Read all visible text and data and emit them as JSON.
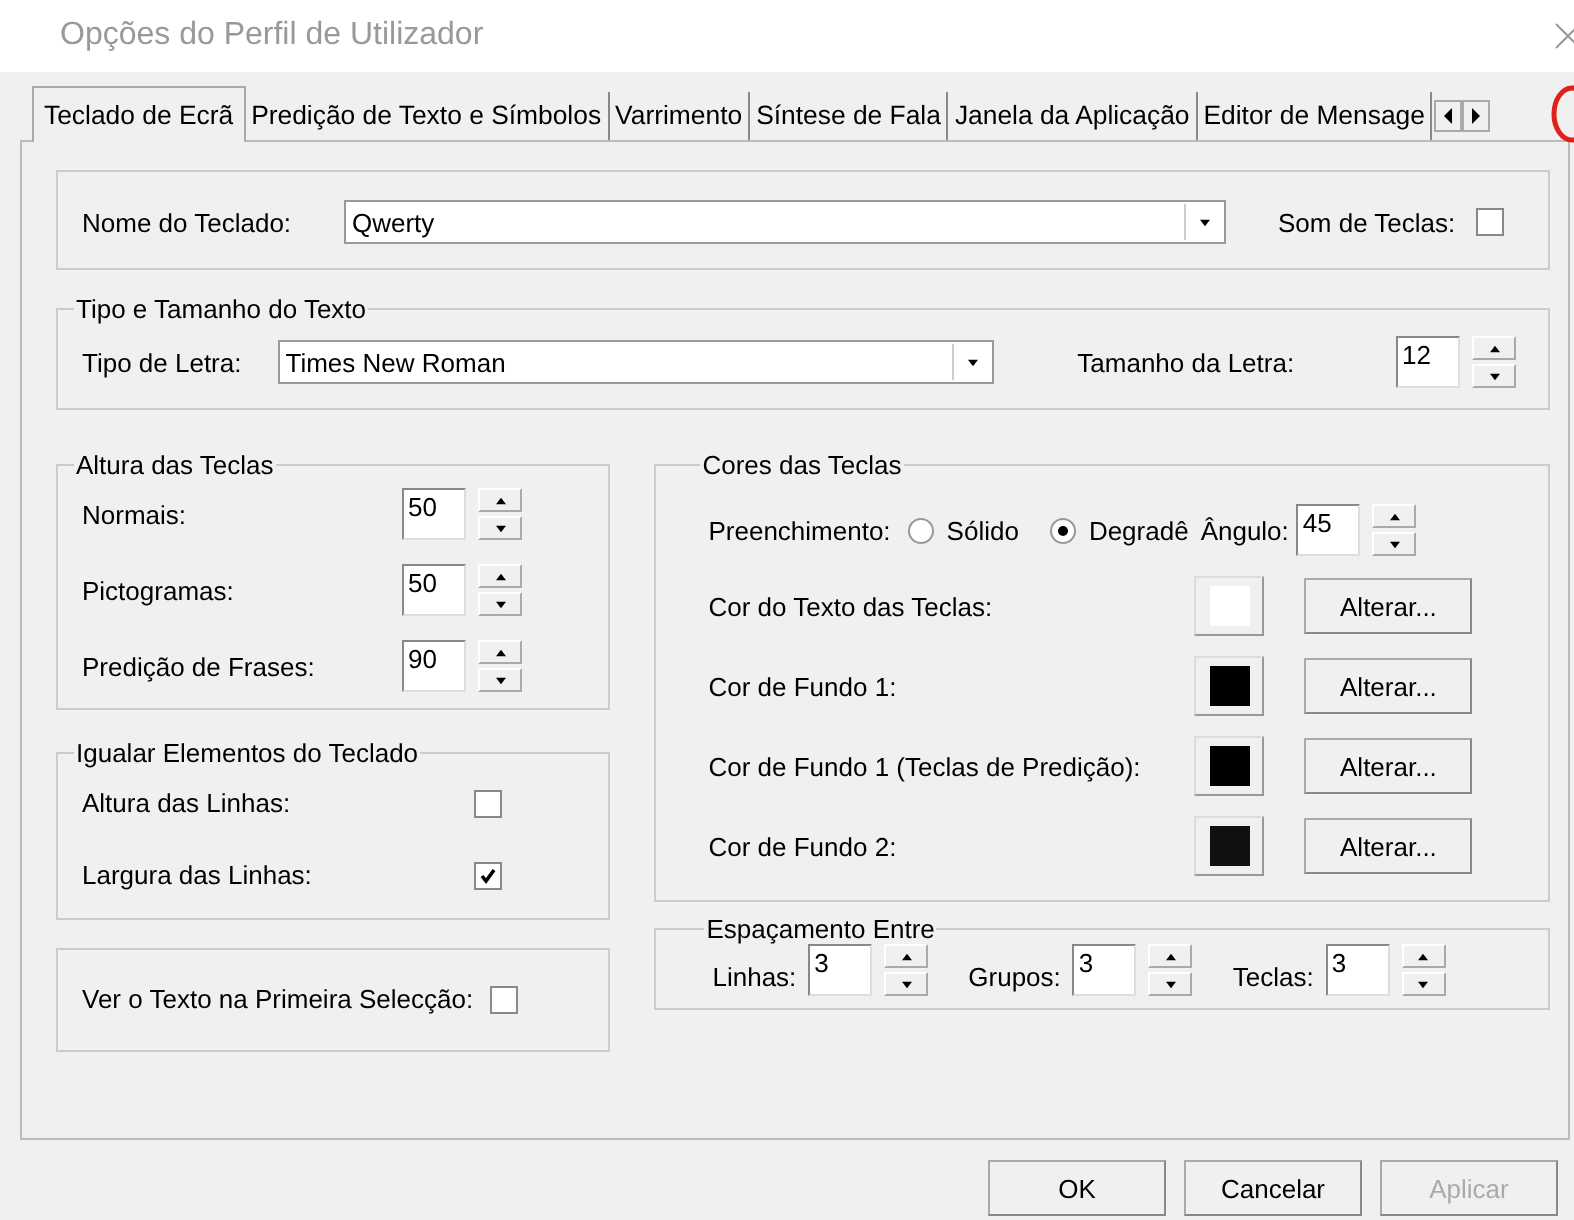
{
  "window": {
    "title": "Opções do Perfil de Utilizador"
  },
  "tabs": [
    {
      "label": "Teclado de Ecrã",
      "selected": true
    },
    {
      "label": "Predição de Texto e Símbolos",
      "selected": false
    },
    {
      "label": "Varrimento",
      "selected": false
    },
    {
      "label": "Síntese de Fala",
      "selected": false
    },
    {
      "label": "Janela da Aplicação",
      "selected": false
    },
    {
      "label": "Editor de Mensage",
      "selected": false
    }
  ],
  "keyboard": {
    "label": "Nome do Teclado:",
    "value": "Qwerty",
    "sound_label": "Som de Teclas:",
    "sound_checked": false
  },
  "text_group": {
    "title": "Tipo e Tamanho do Texto",
    "font_label": "Tipo de Letra:",
    "font_value": "Times New Roman",
    "size_label": "Tamanho da Letra:",
    "size_value": "12"
  },
  "key_height": {
    "title": "Altura das Teclas",
    "rows": [
      {
        "label": "Normais:",
        "value": "50"
      },
      {
        "label": "Pictogramas:",
        "value": "50"
      },
      {
        "label": "Predição de Frases:",
        "value": "90"
      }
    ]
  },
  "equalize": {
    "title": "Igualar Elementos do Teclado",
    "rows": [
      {
        "label": "Altura das Linhas:",
        "checked": false
      },
      {
        "label": "Largura das Linhas:",
        "checked": true
      }
    ]
  },
  "show_text": {
    "label": "Ver o Texto na Primeira Selecção:",
    "checked": false
  },
  "key_colors": {
    "title": "Cores das Teclas",
    "fill_label": "Preenchimento:",
    "fill_options": [
      {
        "label": "Sólido",
        "selected": false
      },
      {
        "label": "Degradê",
        "selected": true
      }
    ],
    "angle_label": "Ângulo:",
    "angle_value": "45",
    "rows": [
      {
        "label": "Cor do Texto das Teclas:",
        "color": "#ffffff",
        "button": "Alterar..."
      },
      {
        "label": "Cor de Fundo 1:",
        "color": "#000000",
        "button": "Alterar..."
      },
      {
        "label": "Cor de Fundo 1  (Teclas de Predição):",
        "color": "#000000",
        "button": "Alterar..."
      },
      {
        "label": "Cor de Fundo 2:",
        "color": "#111111",
        "button": "Alterar..."
      }
    ]
  },
  "spacing": {
    "title": "Espaçamento Entre",
    "fields": [
      {
        "label": "Linhas:",
        "value": "3"
      },
      {
        "label": "Grupos:",
        "value": "3"
      },
      {
        "label": "Teclas:",
        "value": "3"
      }
    ]
  },
  "buttons": [
    {
      "label": "OK",
      "disabled": false
    },
    {
      "label": "Cancelar",
      "disabled": false
    },
    {
      "label": "Aplicar",
      "disabled": true
    }
  ]
}
